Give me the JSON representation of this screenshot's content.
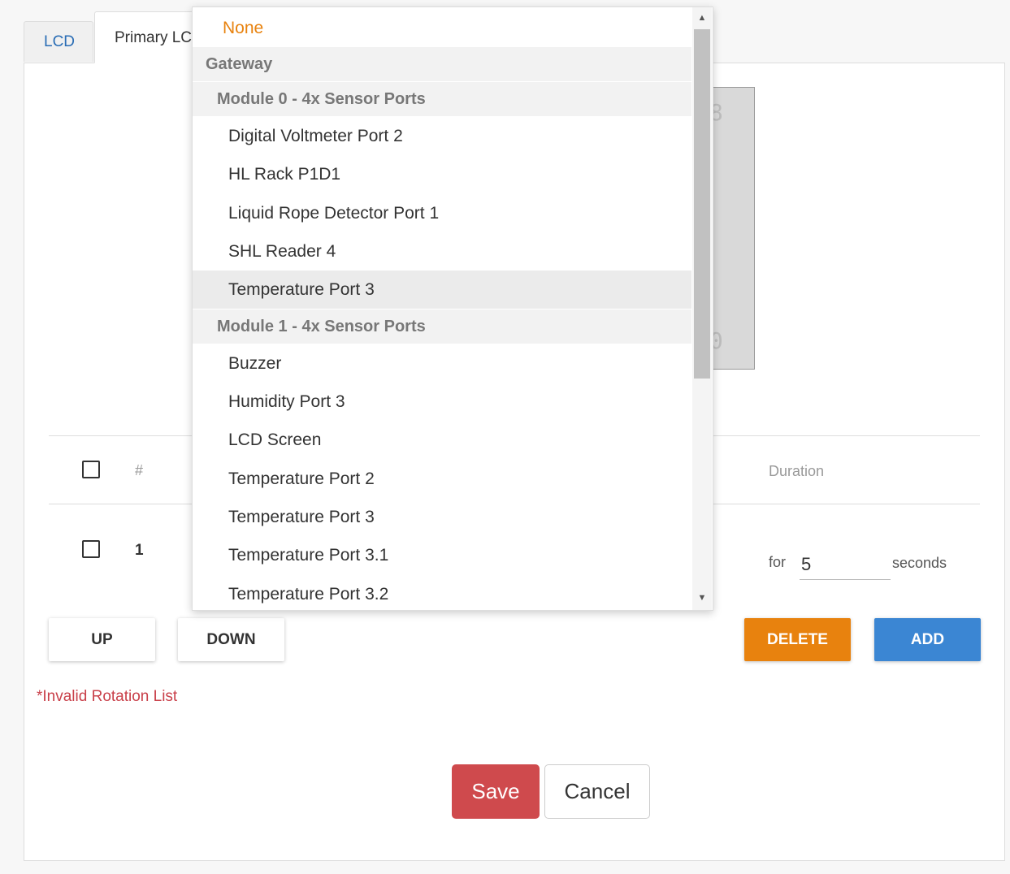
{
  "tabs": [
    {
      "label": "LCD"
    },
    {
      "label": "Primary LCD"
    }
  ],
  "preview_glyphs": [
    "8",
    "0"
  ],
  "table": {
    "headers": {
      "number": "#",
      "duration": "Duration"
    },
    "rows": [
      {
        "number": "1",
        "for_label": "for",
        "duration_value": "5",
        "seconds_label": "seconds"
      }
    ]
  },
  "buttons": {
    "up": "UP",
    "down": "DOWN",
    "delete": "DELETE",
    "add": "ADD",
    "save": "Save",
    "cancel": "Cancel"
  },
  "error_message": "*Invalid Rotation List",
  "dropdown": {
    "none_label": "None",
    "group_gateway": "Gateway",
    "module0": {
      "label": "Module 0 - 4x Sensor Ports",
      "items": [
        "Digital Voltmeter Port 2",
        "HL Rack P1D1",
        "Liquid Rope Detector Port 1",
        "SHL Reader 4",
        "Temperature Port 3"
      ]
    },
    "module1": {
      "label": "Module 1 - 4x Sensor Ports",
      "items": [
        "Buzzer",
        "Humidity Port 3",
        "LCD Screen",
        "Temperature Port 2",
        "Temperature Port 3",
        "Temperature Port 3.1",
        "Temperature Port 3.2"
      ]
    },
    "highlighted_item": "Temperature Port 3"
  },
  "colors": {
    "accent_orange": "#e8820e",
    "accent_blue": "#3b86d3",
    "save_red": "#cf4a4d",
    "error_red": "#c9404a",
    "tab_link_blue": "#2a6db5"
  }
}
